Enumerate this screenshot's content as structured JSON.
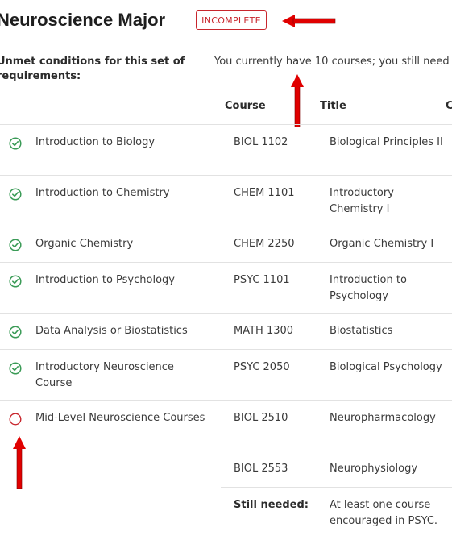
{
  "header": {
    "title": "Neuroscience Major",
    "status_badge": "INCOMPLETE"
  },
  "unmet_label": "Unmet conditions for this set of requirements:",
  "currently_text": "You currently have 10 courses; you still need",
  "table": {
    "col_course": "Course",
    "col_title": "Title",
    "col_extra": "C"
  },
  "rows": [
    {
      "requirement": "Introduction to Biology",
      "course": "BIOL 1102",
      "title": "Biological Principles II",
      "status": "complete"
    },
    {
      "requirement": "Introduction to Chemistry",
      "course": "CHEM 1101",
      "title": "Introductory Chemistry I",
      "status": "complete"
    },
    {
      "requirement": "Organic Chemistry",
      "course": "CHEM 2250",
      "title": "Organic Chemistry I",
      "status": "complete"
    },
    {
      "requirement": "Introduction to Psychology",
      "course": "PSYC 1101",
      "title": "Introduction to Psychology",
      "status": "complete"
    },
    {
      "requirement": "Data Analysis or Biostatistics",
      "course": "MATH 1300",
      "title": "Biostatistics",
      "status": "complete"
    },
    {
      "requirement": "Introductory Neuroscience Course",
      "course": "PSYC 2050",
      "title": "Biological Psychology",
      "status": "complete"
    },
    {
      "requirement": "Mid-Level Neuroscience Courses",
      "course": "BIOL 2510",
      "title": "Neuropharmacology",
      "status": "incomplete"
    },
    {
      "requirement": "",
      "course": "BIOL 2553",
      "title": "Neurophysiology",
      "status": ""
    }
  ],
  "still_needed": {
    "label": "Still needed:",
    "text": "At least one course encouraged in PSYC."
  },
  "colors": {
    "complete": "#3b9b57",
    "incomplete": "#c8262d",
    "annotation_arrow": "#e00000"
  }
}
